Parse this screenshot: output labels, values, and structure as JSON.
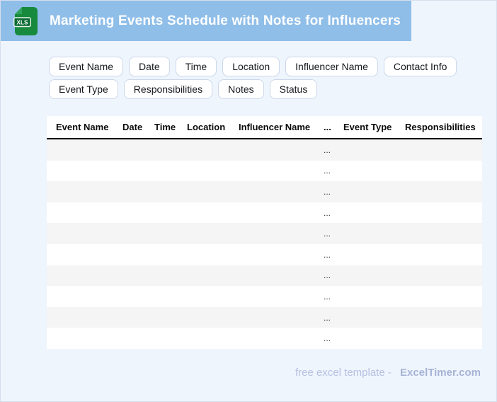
{
  "page": {
    "background_color": "#eff5fd",
    "border_color": "#d6dfec"
  },
  "header": {
    "title": "Marketing Events Schedule with Notes for Influencers",
    "bar_color": "#8fbee9",
    "icon": {
      "name": "xls-file-icon",
      "badge_label": "XLS",
      "body_color": "#178a3e",
      "fold_color": "#2fa35c",
      "badge_color": "#0b6a32"
    }
  },
  "chips": [
    {
      "label": "Event Name"
    },
    {
      "label": "Date"
    },
    {
      "label": "Time"
    },
    {
      "label": "Location"
    },
    {
      "label": "Influencer Name"
    },
    {
      "label": "Contact Info"
    },
    {
      "label": "Event Type"
    },
    {
      "label": "Responsibilities"
    },
    {
      "label": "Notes"
    },
    {
      "label": "Status"
    }
  ],
  "table": {
    "columns": [
      "Event Name",
      "Date",
      "Time",
      "Location",
      "Influencer Name",
      "...",
      "Event Type",
      "Responsibilities"
    ],
    "stripe_color": "#f5f5f5",
    "header_border_color": "#121212",
    "rows": [
      [
        "",
        "",
        "",
        "",
        "",
        "...",
        "",
        ""
      ],
      [
        "",
        "",
        "",
        "",
        "",
        "...",
        "",
        ""
      ],
      [
        "",
        "",
        "",
        "",
        "",
        "...",
        "",
        ""
      ],
      [
        "",
        "",
        "",
        "",
        "",
        "...",
        "",
        ""
      ],
      [
        "",
        "",
        "",
        "",
        "",
        "...",
        "",
        ""
      ],
      [
        "",
        "",
        "",
        "",
        "",
        "...",
        "",
        ""
      ],
      [
        "",
        "",
        "",
        "",
        "",
        "...",
        "",
        ""
      ],
      [
        "",
        "",
        "",
        "",
        "",
        "...",
        "",
        ""
      ],
      [
        "",
        "",
        "",
        "",
        "",
        "...",
        "",
        ""
      ],
      [
        "",
        "",
        "",
        "",
        "",
        "...",
        "",
        ""
      ]
    ]
  },
  "footer": {
    "text": "free excel template -",
    "brand": "ExcelTimer.com",
    "text_color": "#b6c1e2",
    "brand_color": "#a6b3d6"
  }
}
